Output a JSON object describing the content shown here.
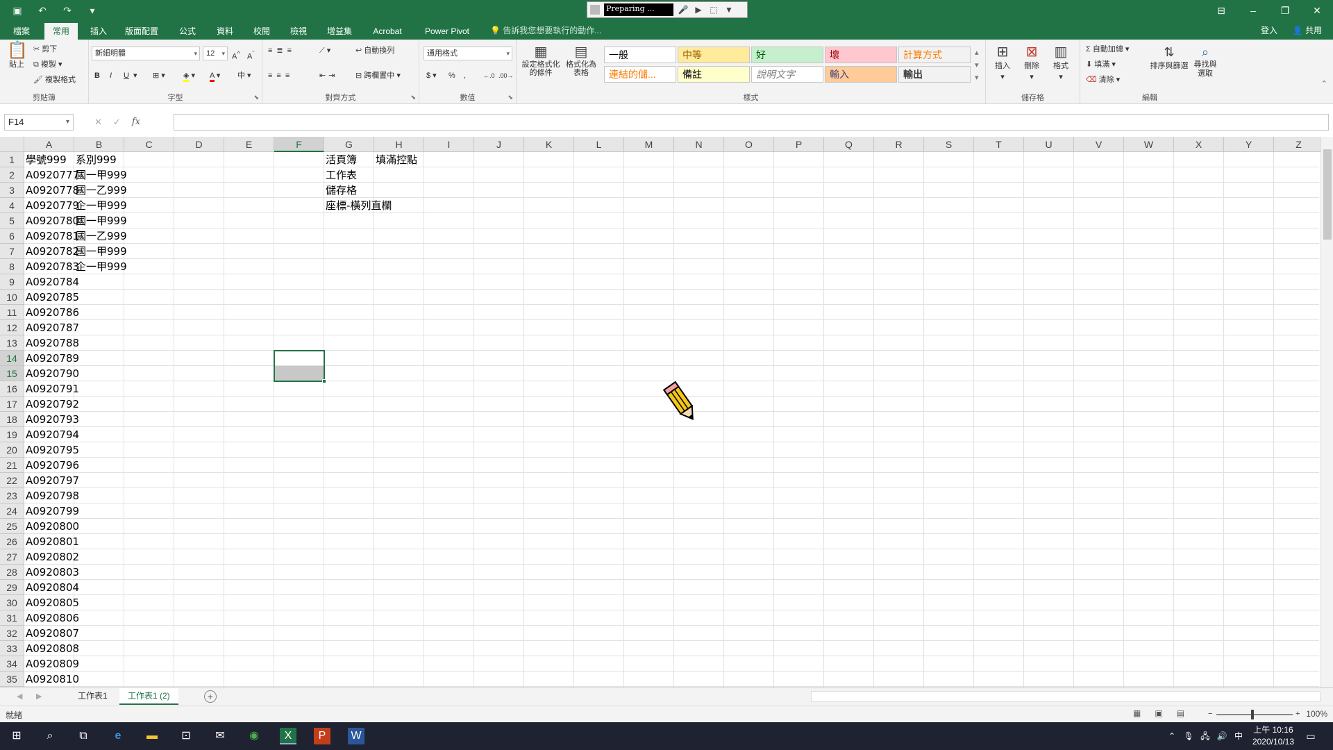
{
  "window": {
    "recorder_label": "Preparing ...",
    "minimize": "–",
    "restore": "❐",
    "close": "✕",
    "display_opts": "⊟"
  },
  "tabs": [
    "檔案",
    "常用",
    "插入",
    "版面配置",
    "公式",
    "資料",
    "校閱",
    "檢視",
    "增益集",
    "Acrobat",
    "Power Pivot"
  ],
  "active_tab_index": 1,
  "tell_me": "告訴我您想要執行的動作...",
  "login": "登入",
  "share": "共用",
  "ribbon": {
    "clipboard": {
      "label": "剪貼簿",
      "paste": "貼上",
      "cut": "剪下",
      "copy": "複製",
      "format_painter": "複製格式"
    },
    "font": {
      "label": "字型",
      "name": "新細明體",
      "size": "12",
      "bold": "B",
      "italic": "I",
      "underline": "U"
    },
    "alignment": {
      "label": "對齊方式",
      "wrap": "自動換列",
      "merge": "跨欄置中"
    },
    "number": {
      "label": "數值",
      "format": "通用格式",
      "currency": "$",
      "percent": "%",
      "comma": ","
    },
    "styles": {
      "label": "樣式",
      "conditional": "設定格式化的條件",
      "as_table": "格式化為表格",
      "boxes": [
        {
          "text": "一般",
          "bg": "#ffffff",
          "fg": "#000000"
        },
        {
          "text": "中等",
          "bg": "#ffeb9c",
          "fg": "#9c5700"
        },
        {
          "text": "好",
          "bg": "#c6efce",
          "fg": "#006100"
        },
        {
          "text": "壞",
          "bg": "#ffc7ce",
          "fg": "#9c0006"
        },
        {
          "text": "計算方式",
          "bg": "#f2f2f2",
          "fg": "#fa7d00"
        },
        {
          "text": "連結的儲...",
          "bg": "#ffffff",
          "fg": "#fa7d00"
        },
        {
          "text": "備註",
          "bg": "#ffffcc",
          "fg": "#000000"
        },
        {
          "text": "說明文字",
          "bg": "#ffffff",
          "fg": "#7f7f7f"
        },
        {
          "text": "輸入",
          "bg": "#ffcc99",
          "fg": "#3f3f76"
        },
        {
          "text": "輸出",
          "bg": "#f2f2f2",
          "fg": "#3f3f3f"
        }
      ]
    },
    "cells": {
      "label": "儲存格",
      "insert": "插入",
      "delete": "刪除",
      "format": "格式"
    },
    "editing": {
      "label": "編輯",
      "autosum": "自動加總",
      "fill": "填滿",
      "clear": "清除",
      "sort": "排序與篩選",
      "find": "尋找與選取"
    }
  },
  "formula_bar": {
    "name_box": "F14",
    "cancel": "✕",
    "enter": "✓",
    "fx": "fx",
    "value": ""
  },
  "columns": [
    "A",
    "B",
    "C",
    "D",
    "E",
    "F",
    "G",
    "H",
    "I",
    "J",
    "K",
    "L",
    "M",
    "N",
    "O",
    "P",
    "Q",
    "R",
    "S",
    "T",
    "U",
    "V",
    "W",
    "X",
    "Y",
    "Z"
  ],
  "rows": [
    "1",
    "2",
    "3",
    "4",
    "5",
    "6",
    "7",
    "8",
    "9",
    "10",
    "11",
    "12",
    "13",
    "14",
    "15",
    "16",
    "17",
    "18",
    "19",
    "20",
    "21",
    "22",
    "23",
    "24",
    "25",
    "26",
    "27",
    "28",
    "29",
    "30",
    "31",
    "32",
    "33",
    "34",
    "35"
  ],
  "cells": {
    "A": [
      "學號999",
      "A0920777",
      "A0920778",
      "A0920779",
      "A0920780",
      "A0920781",
      "A0920782",
      "A0920783",
      "A0920784",
      "A0920785",
      "A0920786",
      "A0920787",
      "A0920788",
      "A0920789",
      "A0920790",
      "A0920791",
      "A0920792",
      "A0920793",
      "A0920794",
      "A0920795",
      "A0920796",
      "A0920797",
      "A0920798",
      "A0920799",
      "A0920800",
      "A0920801",
      "A0920802",
      "A0920803",
      "A0920804",
      "A0920805",
      "A0920806",
      "A0920807",
      "A0920808",
      "A0920809",
      "A0920810"
    ],
    "B": [
      "系別999",
      "國一甲999",
      "國一乙999",
      "企一甲999",
      "國一甲999",
      "國一乙999",
      "國一甲999",
      "企一甲999"
    ],
    "G": [
      "活頁簿",
      "工作表",
      "儲存格",
      "座標-橫列直欄"
    ],
    "H": [
      "填滿控點"
    ]
  },
  "selected_cell": "F14",
  "sheets": [
    "工作表1",
    "工作表1 (2)"
  ],
  "active_sheet_index": 1,
  "status": {
    "ready": "就緒",
    "zoom": "100%"
  },
  "clock": {
    "time": "上午 10:16",
    "date": "2020/10/13"
  },
  "ime": "中",
  "colors": {
    "excel_green": "#217346",
    "taskbar": "#1f2230"
  }
}
